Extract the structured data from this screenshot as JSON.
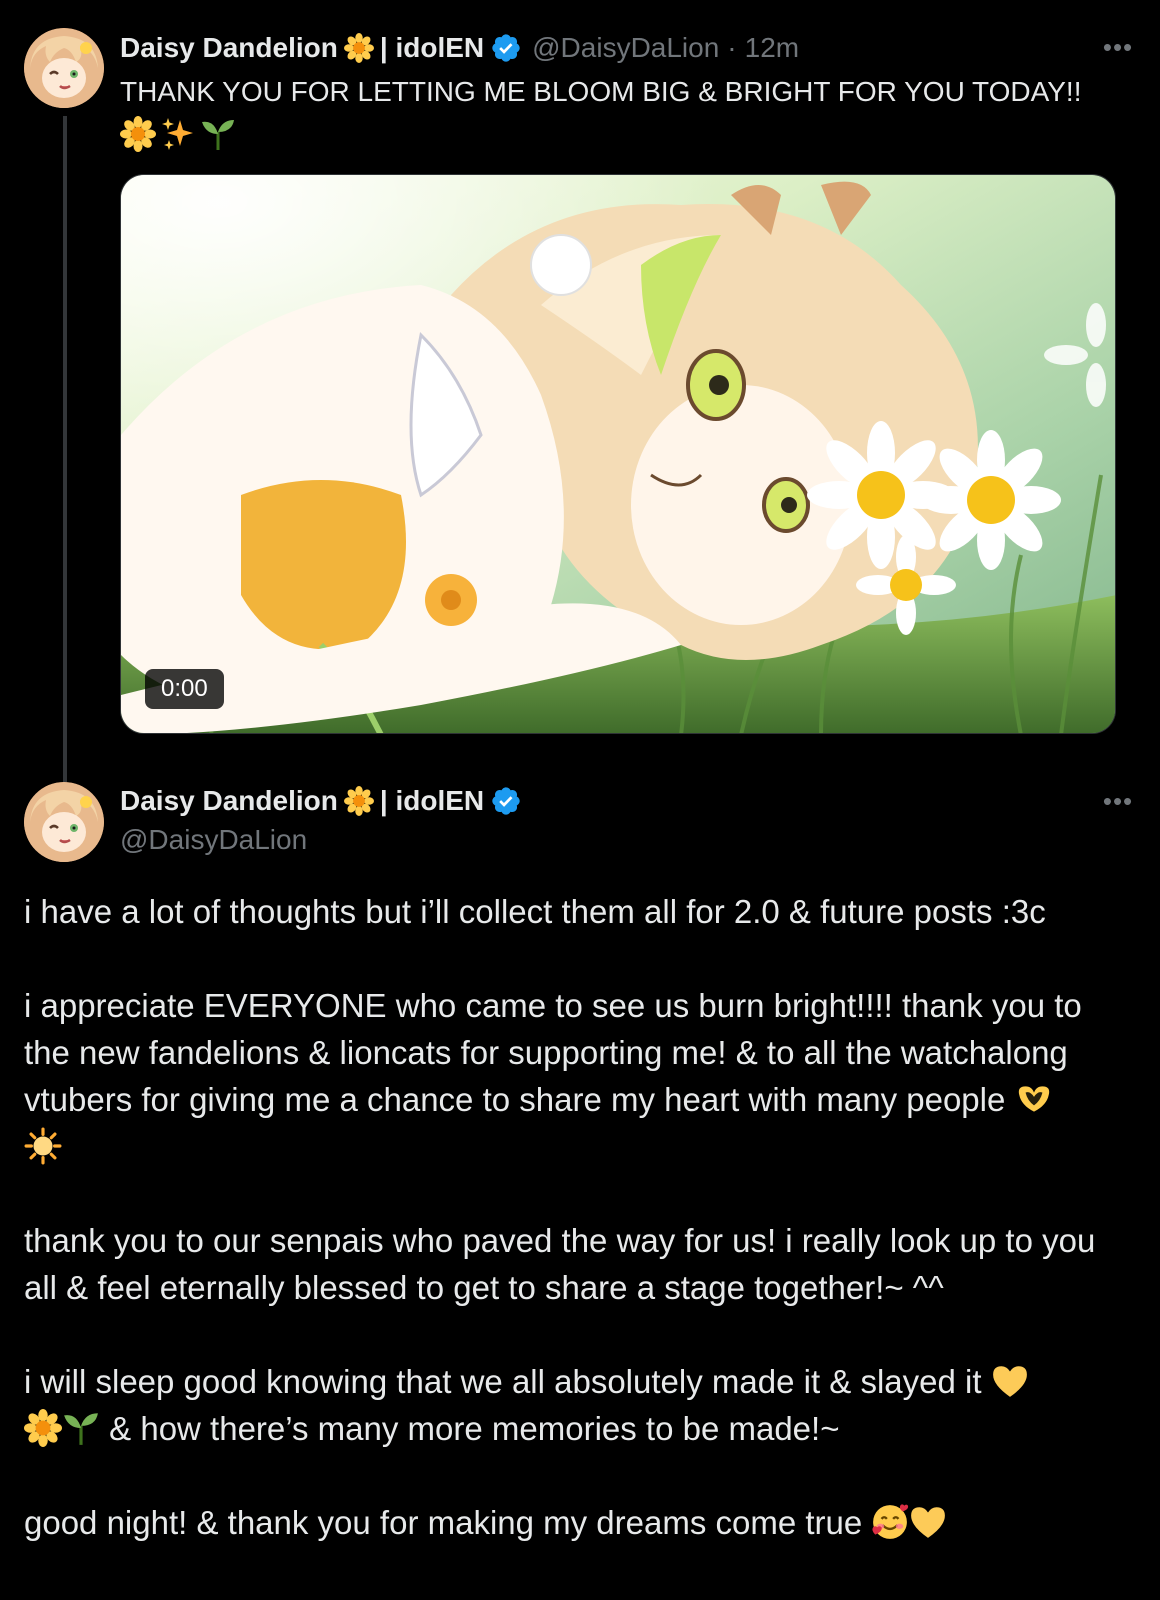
{
  "colors": {
    "background": "#000000",
    "text": "#e7e9ea",
    "muted": "#71767b",
    "verified": "#1d9bf0",
    "thread_line": "#333639"
  },
  "tweet1": {
    "display_name": "Daisy Dandelion",
    "name_suffix": "| idolEN",
    "handle": "@DaisyDaLion",
    "separator": "·",
    "time": "12m",
    "more_icon": "•••",
    "text": "THANK YOU FOR LETTING ME BLOOM BIG & BRIGHT FOR YOU TODAY!!",
    "emojis": [
      "daisy-icon",
      "sparkles-icon",
      "seedling-icon"
    ],
    "video": {
      "timestamp": "0:00"
    }
  },
  "tweet2": {
    "display_name": "Daisy Dandelion",
    "name_suffix": "| idolEN",
    "handle": "@DaisyDaLion",
    "more_icon": "•••",
    "paragraphs": {
      "p1": "i have a lot of thoughts but i’ll collect them all for 2.0 & future posts :3c",
      "p2": "i appreciate EVERYONE who came to see us burn bright!!!! thank you to the new fandelions & lioncats for supporting me! & to all the watchalong vtubers for giving me a chance to share my heart with many people",
      "p3": "thank you to our senpais who paved the way for us! i really look up to you all & feel eternally blessed to get to share a stage together!~ ^^",
      "p4a": "i will sleep good knowing that we all absolutely made it & slayed it",
      "p4b": "& how there’s many more memories to be made!~",
      "p5": "good night! & thank you for making my dreams come true"
    }
  }
}
